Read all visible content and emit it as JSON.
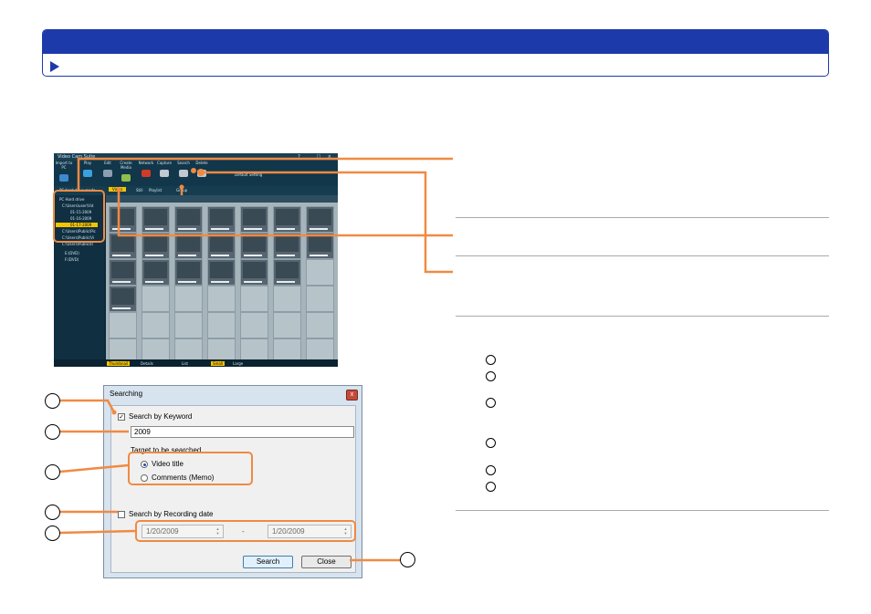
{
  "app": {
    "title": "Video Cam Suite",
    "toolbar": [
      {
        "label": "Import to PC",
        "color": "#3d8ad0"
      },
      {
        "label": "Play",
        "color": "#3aa0e0"
      },
      {
        "label": "Edit",
        "color": "#8aa0b0"
      },
      {
        "label": "Create Media",
        "color": "#8fbf4a"
      },
      {
        "label": "Network",
        "color": "#d23a2a"
      },
      {
        "label": "Capture",
        "color": "#c0c8d0"
      },
      {
        "label": "Search",
        "color": "#c0c8d0"
      },
      {
        "label": "Delete",
        "color": "#c0c8d0"
      }
    ],
    "default_setting": "Default Setting",
    "mode_label": "PC hard drive mode",
    "tabs": [
      "Video",
      "Still",
      "Playlist",
      "Group"
    ],
    "tree": [
      {
        "text": "PC Hard drive",
        "selected": false
      },
      {
        "text": "C:\\Users\\user\\Vid",
        "selected": false
      },
      {
        "text": "01-15-2009",
        "selected": false
      },
      {
        "text": "01-16-2009",
        "selected": false
      },
      {
        "text": "01-17-2009",
        "selected": true
      },
      {
        "text": "C:\\Users\\Public\\Pic",
        "selected": false
      },
      {
        "text": "C:\\Users\\Public\\Vi",
        "selected": false
      },
      {
        "text": "C:\\Users\\Public\\R",
        "selected": false
      },
      {
        "text": "E:(DVD)",
        "selected": false
      },
      {
        "text": "F:(DVD)",
        "selected": false
      }
    ],
    "status": [
      "Thumbnail",
      "Details",
      "List",
      "Small",
      "Large"
    ]
  },
  "dialog": {
    "title": "Searching",
    "keyword_checkbox": {
      "label": "Search by Keyword",
      "checked": true
    },
    "keyword_value": "2009",
    "target_label": "Target to be searched",
    "radios": [
      {
        "label": "Video title",
        "selected": true
      },
      {
        "label": "Comments (Memo)",
        "selected": false
      }
    ],
    "date_checkbox": {
      "label": "Search by Recording date",
      "checked": false
    },
    "date_from": "1/20/2009",
    "date_separator": "-",
    "date_to": "1/20/2009",
    "search_button": "Search",
    "close_button": "Close"
  },
  "colors": {
    "header": "#1c3aa9",
    "callout": "#f08a42"
  }
}
